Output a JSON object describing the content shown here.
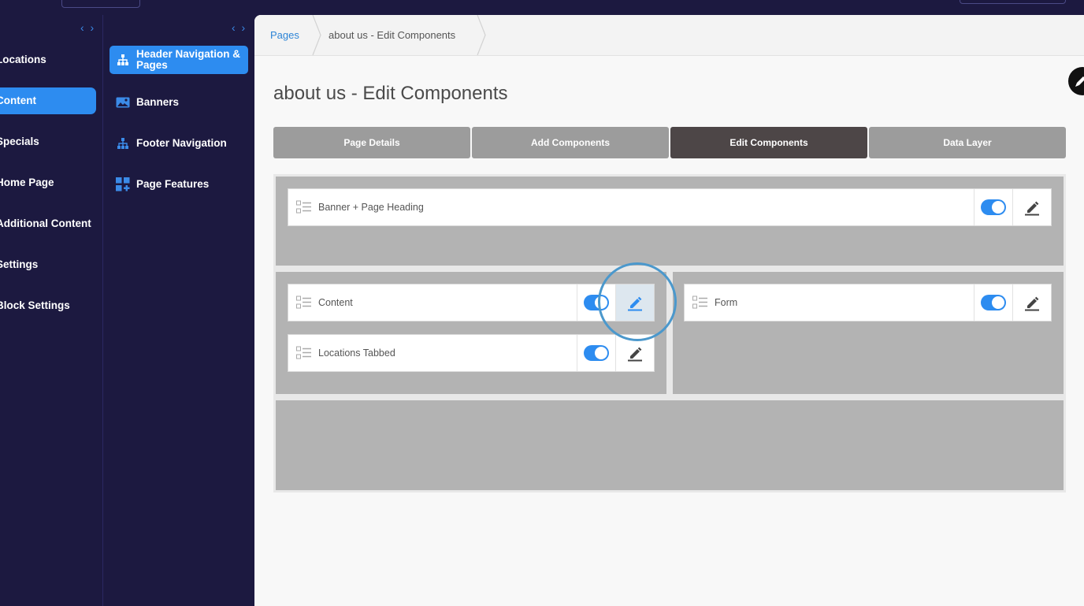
{
  "sidebar_primary": {
    "collapse_glyph": "‹ ›",
    "items": [
      {
        "label": "Locations",
        "active": false
      },
      {
        "label": "Content",
        "active": true
      },
      {
        "label": "Specials",
        "active": false
      },
      {
        "label": "Home Page",
        "active": false
      },
      {
        "label": "Additional Content",
        "active": false
      },
      {
        "label": "Settings",
        "active": false
      },
      {
        "label": "Block Settings",
        "active": false
      }
    ]
  },
  "sidebar_secondary": {
    "collapse_glyph": "‹ ›",
    "items": [
      {
        "label": "Header Navigation & Pages",
        "icon": "sitemap-icon",
        "active": true
      },
      {
        "label": "Banners",
        "icon": "image-icon",
        "active": false
      },
      {
        "label": "Footer Navigation",
        "icon": "sitemap-icon",
        "active": false
      },
      {
        "label": "Page Features",
        "icon": "grid-plus-icon",
        "active": false
      }
    ]
  },
  "breadcrumb": {
    "items": [
      "Pages",
      "about us - Edit Components"
    ]
  },
  "page": {
    "title": "about us - Edit Components"
  },
  "tabs": [
    {
      "label": "Page Details",
      "active": false
    },
    {
      "label": "Add Components",
      "active": false
    },
    {
      "label": "Edit Components",
      "active": true
    },
    {
      "label": "Data Layer",
      "active": false
    }
  ],
  "components": {
    "row1": [
      {
        "name": "Banner + Page Heading",
        "enabled": true
      }
    ],
    "row2_left": [
      {
        "name": "Content",
        "enabled": true,
        "hovered": true
      },
      {
        "name": "Locations Tabbed",
        "enabled": true
      }
    ],
    "row2_right": [
      {
        "name": "Form",
        "enabled": true
      }
    ]
  },
  "colors": {
    "sidebar_bg": "#1c1940",
    "accent": "#2d8cf0",
    "active_tab": "#4d4647",
    "inactive_tab": "#9c9c9c",
    "zone": "#b3b3b3",
    "focus_ring": "#4b98cc"
  }
}
